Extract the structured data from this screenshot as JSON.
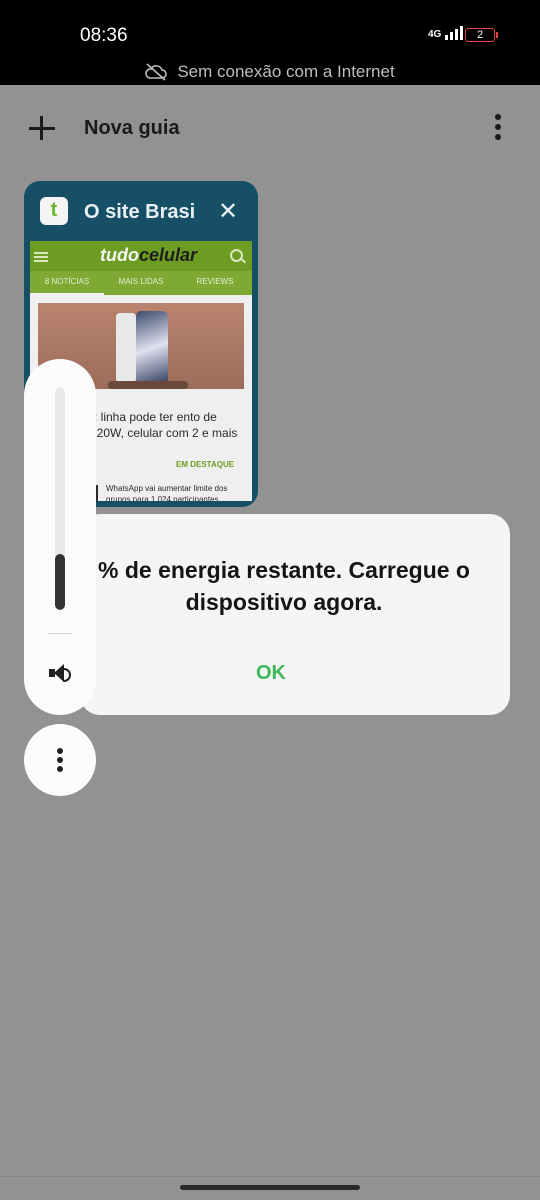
{
  "status_bar": {
    "time": "08:36",
    "network": "4G",
    "battery": "2"
  },
  "offline_banner": {
    "text": "Sem conexão com a Internet"
  },
  "header": {
    "new_tab_label": "Nova guia"
  },
  "tab_card": {
    "title": "O site Brasi",
    "favicon_letter": "t",
    "preview": {
      "site_logo_a": "tudo",
      "site_logo_b": "celular",
      "tabs": [
        "8 NOTÍCIAS",
        "MAIS LIDAS",
        "REVIEWS"
      ],
      "headline": "): linha pode ter ento de 120W, celular com 2 e mais",
      "tag": "EM DESTAQUE",
      "second_headline": "WhatsApp vai aumentar limite dos grupos para 1.024 participantes"
    }
  },
  "dialog": {
    "message": "% de energia restante. Carregue o dispositivo agora.",
    "ok_label": "OK"
  },
  "volume": {
    "level_fraction": 0.25
  },
  "colors": {
    "accent_green": "#40b55a",
    "card_blue": "#164f66",
    "site_green": "#6c9d22"
  }
}
